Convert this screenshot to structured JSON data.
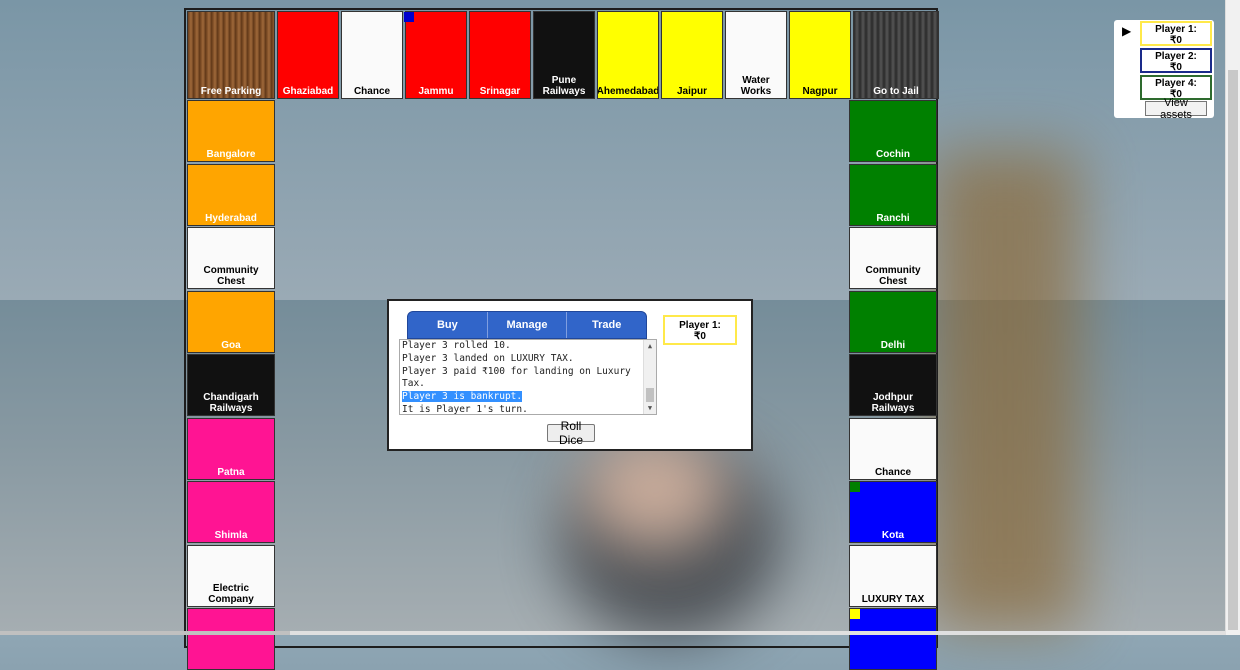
{
  "board": {
    "top_row": [
      {
        "name": "Free Parking",
        "color": "#7a4a24",
        "text": "w"
      },
      {
        "name": "Ghaziabad",
        "color": "#ff0000",
        "text": "w"
      },
      {
        "name": "Chance",
        "color": "#fafafa",
        "text": "k"
      },
      {
        "name": "Jammu",
        "color": "#ff0000",
        "text": "w"
      },
      {
        "name": "Srinagar",
        "color": "#ff0000",
        "text": "w"
      },
      {
        "name": "Pune Railways",
        "color": "#111111",
        "text": "w"
      },
      {
        "name": "Ahemedabad",
        "color": "#ffff00",
        "text": "k"
      },
      {
        "name": "Jaipur",
        "color": "#ffff00",
        "text": "k"
      },
      {
        "name": "Water Works",
        "color": "#fafafa",
        "text": "k"
      },
      {
        "name": "Nagpur",
        "color": "#ffff00",
        "text": "k"
      },
      {
        "name": "Go to Jail",
        "color": "#3a3a3a",
        "text": "w"
      }
    ],
    "left_col": [
      {
        "name": "Bangalore",
        "color": "#ffa500",
        "text": "w"
      },
      {
        "name": "Hyderabad",
        "color": "#ffa500",
        "text": "w"
      },
      {
        "name": "Community Chest",
        "color": "#fafafa",
        "text": "k"
      },
      {
        "name": "Goa",
        "color": "#ffa500",
        "text": "w"
      },
      {
        "name": "Chandigarh Railways",
        "color": "#111111",
        "text": "w"
      },
      {
        "name": "Patna",
        "color": "#ff1493",
        "text": "w"
      },
      {
        "name": "Shimla",
        "color": "#ff1493",
        "text": "w"
      },
      {
        "name": "Electric Company",
        "color": "#fafafa",
        "text": "k"
      },
      {
        "name": "",
        "color": "#ff1493",
        "text": "w"
      }
    ],
    "right_col": [
      {
        "name": "Cochin",
        "color": "#008000",
        "text": "w"
      },
      {
        "name": "Ranchi",
        "color": "#008000",
        "text": "w"
      },
      {
        "name": "Community Chest",
        "color": "#fafafa",
        "text": "k"
      },
      {
        "name": "Delhi",
        "color": "#008000",
        "text": "w"
      },
      {
        "name": "Jodhpur Railways",
        "color": "#111111",
        "text": "w"
      },
      {
        "name": "Chance",
        "color": "#fafafa",
        "text": "k"
      },
      {
        "name": "Kota",
        "color": "#0000ff",
        "text": "w"
      },
      {
        "name": "LUXURY TAX",
        "color": "#fafafa",
        "text": "k"
      },
      {
        "name": "",
        "color": "#0000ff",
        "text": "w"
      }
    ]
  },
  "tokens": {
    "blue": "#0000cc",
    "green": "#008000",
    "yellow": "#ffff00"
  },
  "popup": {
    "tabs": [
      "Buy",
      "Manage",
      "Trade"
    ],
    "log": [
      "Player 3 rolled 10.",
      "Player 3 landed on LUXURY TAX.",
      "Player 3 paid ₹100 for landing on Luxury",
      "Tax.",
      "Player 3 is bankrupt.",
      "It is Player 1's turn."
    ],
    "highlighted_line": 4,
    "current_player": {
      "label": "Player 1:",
      "money": "₹0"
    },
    "roll_button": "Roll Dice"
  },
  "players_panel": {
    "arrow": "▶",
    "players": [
      {
        "label": "Player 1:",
        "money": "₹0",
        "color": "#ffe94a"
      },
      {
        "label": "Player 2:",
        "money": "₹0",
        "color": "#1a2a8a"
      },
      {
        "label": "Player 4:",
        "money": "₹0",
        "color": "#2e6b2e"
      }
    ],
    "view_assets": "View assets"
  }
}
